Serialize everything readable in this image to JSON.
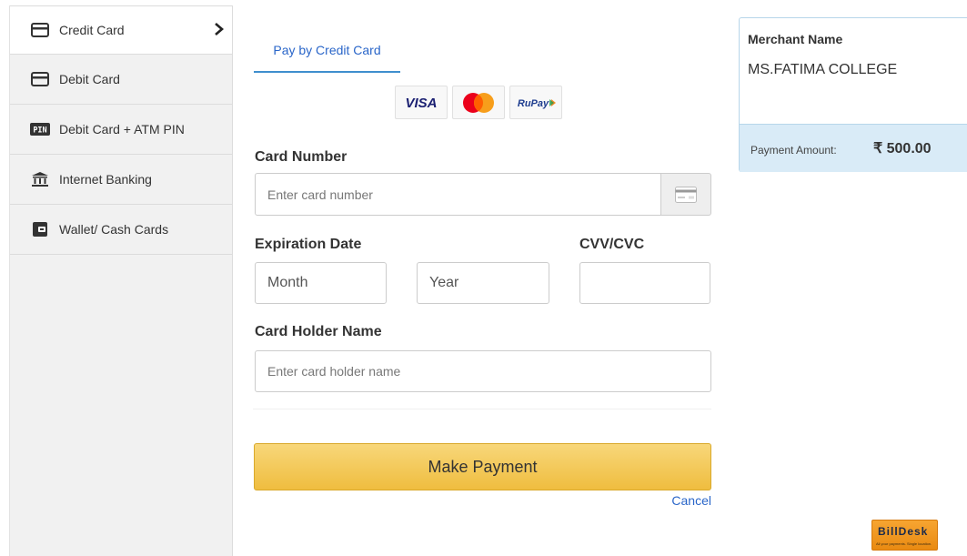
{
  "sidebar": {
    "items": [
      {
        "label": "Credit Card",
        "icon": "credit-card-icon",
        "active": true
      },
      {
        "label": "Debit Card",
        "icon": "debit-card-icon",
        "active": false
      },
      {
        "label": "Debit Card + ATM PIN",
        "icon": "pin-icon",
        "active": false
      },
      {
        "label": "Internet Banking",
        "icon": "bank-icon",
        "active": false
      },
      {
        "label": "Wallet/ Cash Cards",
        "icon": "wallet-icon",
        "active": false
      }
    ],
    "pin_badge": "PIN"
  },
  "tab": {
    "label": "Pay by Credit Card"
  },
  "brands": {
    "visa": "VISA",
    "rupay": "RuPay"
  },
  "form": {
    "card_number_label": "Card Number",
    "card_number_placeholder": "Enter card number",
    "expiry_label": "Expiration Date",
    "month_placeholder": "Month",
    "year_placeholder": "Year",
    "cvv_label": "CVV/CVC",
    "holder_label": "Card Holder Name",
    "holder_placeholder": "Enter card holder name"
  },
  "actions": {
    "pay_label": "Make Payment",
    "cancel_label": "Cancel"
  },
  "merchant": {
    "name_label": "Merchant Name",
    "name_value": "MS.FATIMA COLLEGE",
    "amount_label": "Payment Amount:",
    "amount_value": "₹ 500.00"
  },
  "footer": {
    "brand": "BillDesk",
    "tagline": "All your payments. Single location."
  },
  "colors": {
    "accent_blue": "#2a66c9",
    "button_yellow": "#efbd3f",
    "merchant_bg": "#d9ebf7"
  }
}
